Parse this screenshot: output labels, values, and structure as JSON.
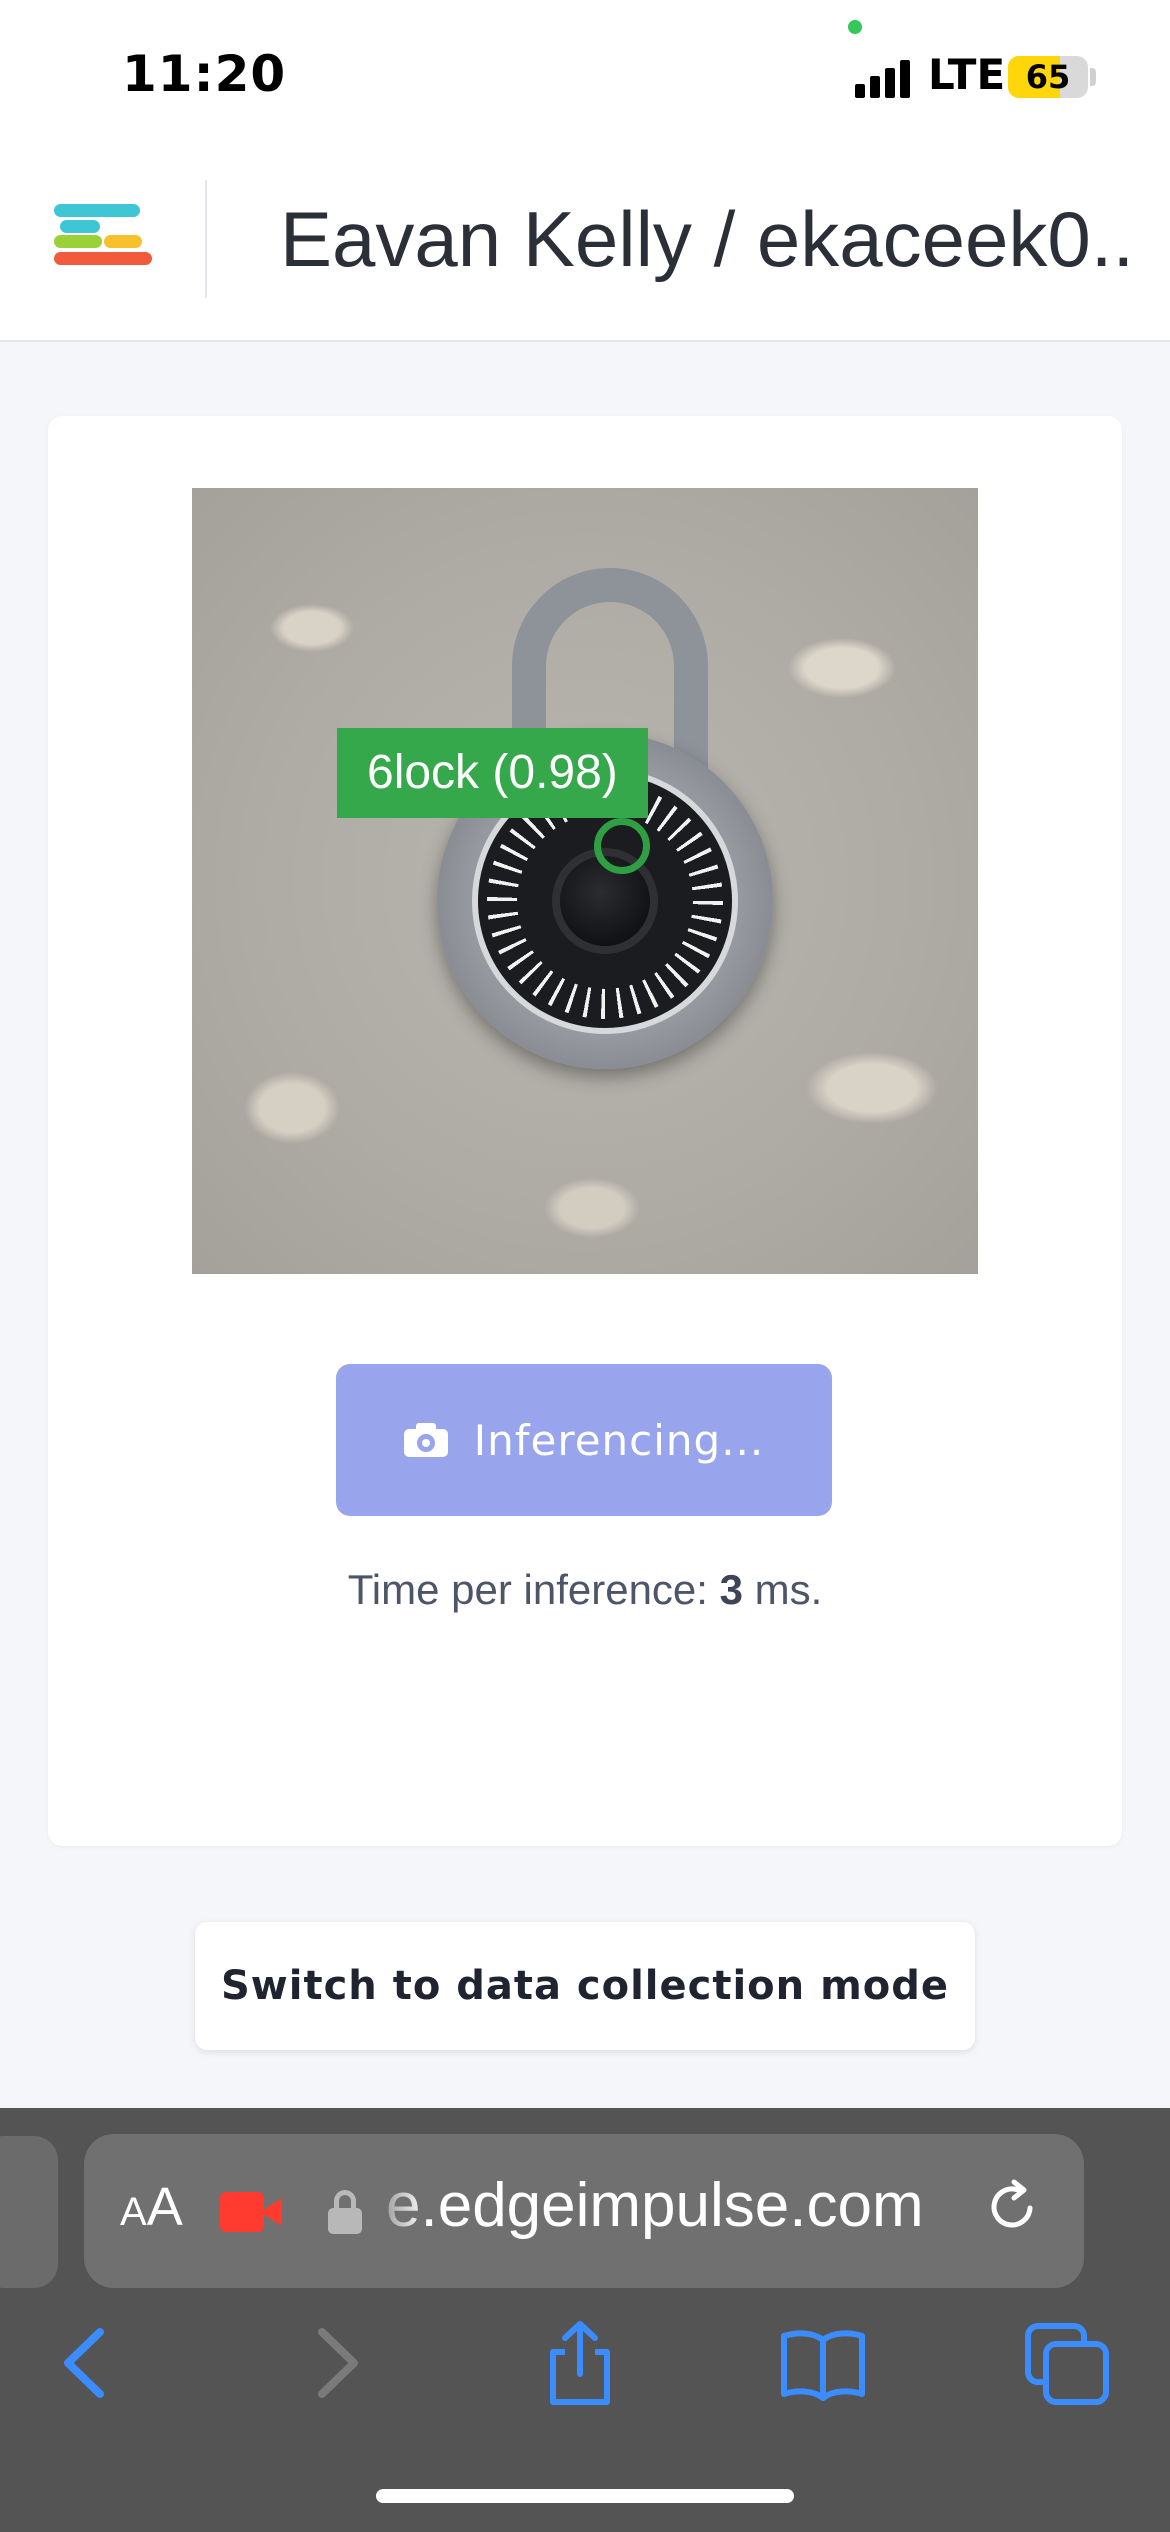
{
  "status_bar": {
    "time": "11:20",
    "network": "LTE",
    "battery_percent": "65",
    "battery_level": 0.65
  },
  "header": {
    "menu_icon": "edge-impulse-logo-menu-icon",
    "title": "Eavan Kelly / ekaceek0..."
  },
  "camera": {
    "detection_label": "6lock (0.98)",
    "marker_color": "#2ea043"
  },
  "capture_button": {
    "icon": "camera-icon",
    "label": "Inferencing..."
  },
  "inference": {
    "prefix": "Time per inference:",
    "value": "3",
    "suffix": "ms."
  },
  "mode_button": {
    "label": "Switch to data collection mode"
  },
  "browser": {
    "text_size_button": "AA",
    "url": "e.edgeimpulse.com",
    "icons": [
      "screen-recording-icon",
      "lock-icon",
      "reload-icon",
      "back-icon",
      "forward-icon",
      "share-icon",
      "bookmarks-icon",
      "tabs-icon"
    ]
  },
  "colors": {
    "accent_button": "#98a5ec",
    "detection_green": "#34a84a",
    "browser_blue": "#3a8cff"
  }
}
